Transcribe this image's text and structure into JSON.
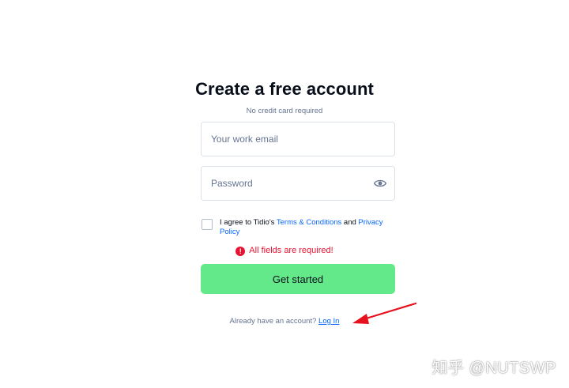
{
  "signup": {
    "title": "Create a free account",
    "subtitle": "No credit card required",
    "email": {
      "placeholder": "Your work email",
      "value": ""
    },
    "password": {
      "placeholder": "Password",
      "value": ""
    },
    "consent": {
      "prefix": "I agree to Tidio's ",
      "terms_link": "Terms & Conditions",
      "middle": " and ",
      "privacy_link": "Privacy Policy",
      "checked": false
    },
    "error_message": "All fields are required!",
    "submit_label": "Get started",
    "login_prompt": "Already have an account? ",
    "login_link": "Log In"
  },
  "icons": {
    "password_toggle": "eye-icon",
    "error": "error-icon",
    "annotation": "red-arrow"
  },
  "watermark": "知乎 @NUTSWP",
  "colors": {
    "accent_button": "#63e88a",
    "link": "#0566ff",
    "error": "#e81332",
    "arrow": "#e8101c",
    "muted_text": "#647491",
    "heading": "#080f1a"
  }
}
